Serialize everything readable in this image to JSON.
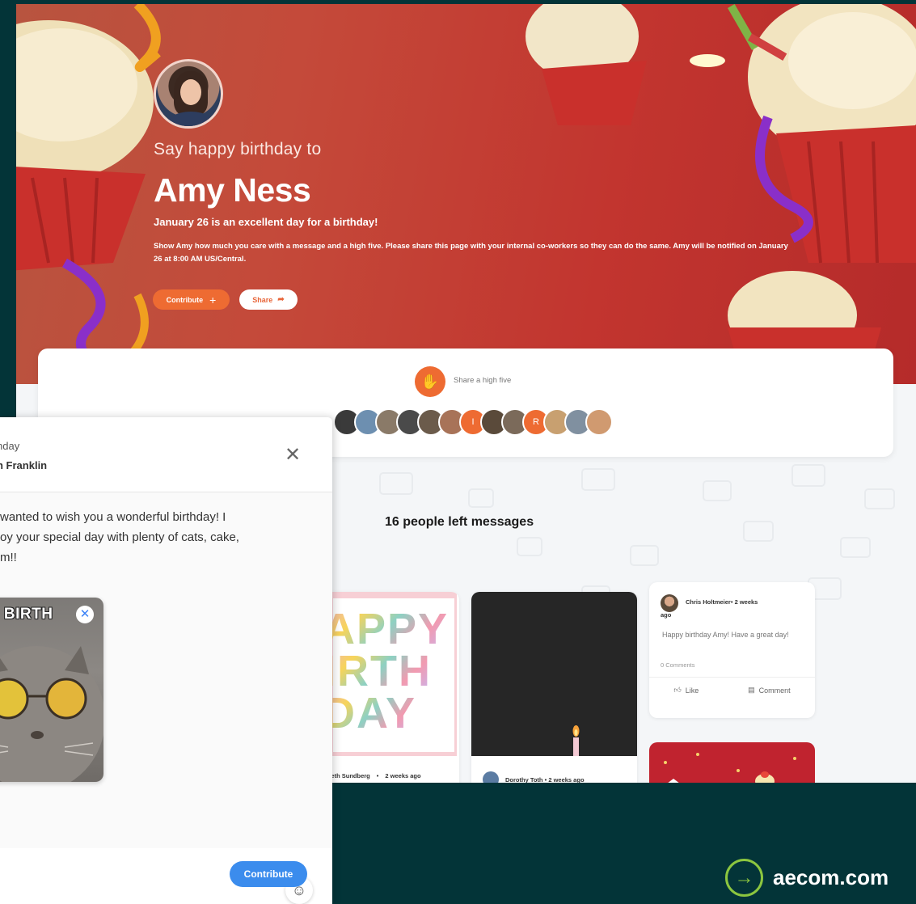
{
  "hero": {
    "say": "Say happy birthday to",
    "name": "Amy Ness",
    "subtitle": "January 26 is an excellent day for a birthday!",
    "description": "Show Amy how much you care with a message and a high five. Please share this page with your internal co-workers so they can do the same. Amy will be notified on January 26 at 8:00 AM US/Central.",
    "contribute_label": "Contribute",
    "share_label": "Share"
  },
  "highfive": {
    "label": "Share a high five",
    "avatars": [
      {
        "initial": "",
        "color": "#3a3a3a"
      },
      {
        "initial": "",
        "color": "#6d8fb0"
      },
      {
        "initial": "",
        "color": "#8a7a68"
      },
      {
        "initial": "",
        "color": "#4a4a4a"
      },
      {
        "initial": "",
        "color": "#6b5b4b"
      },
      {
        "initial": "",
        "color": "#a87358"
      },
      {
        "initial": "I",
        "color": "#ee6b32"
      },
      {
        "initial": "",
        "color": "#5a4a3a"
      },
      {
        "initial": "",
        "color": "#7b6a5a"
      },
      {
        "initial": "R",
        "color": "#ee6b32"
      },
      {
        "initial": "",
        "color": "#c8a070"
      },
      {
        "initial": "",
        "color": "#8090a0"
      },
      {
        "initial": "",
        "color": "#d09a70"
      }
    ]
  },
  "messages": {
    "count_label": "16 people left messages",
    "card1": {
      "art_lines": [
        "APPY",
        "IRTH",
        "DAY"
      ],
      "author": "Beth Sundberg",
      "time": "2 weeks ago"
    },
    "card2": {
      "author": "Dorothy Toth",
      "time": "2 weeks ago"
    },
    "card3": {
      "author": "Chris Holtmeier",
      "time_part1": "2 weeks",
      "time_part2": "ago",
      "message": "Happy birthday Amy! Have a great day!",
      "comments": "0 Comments",
      "like_label": "Like",
      "comment_label": "Comment"
    }
  },
  "modal": {
    "title": "nday",
    "subtitle": "n Franklin",
    "message_lines": [
      " wanted to wish you a wonderful birthday! I",
      "oy your special day with plenty of cats, cake,",
      "m!!"
    ],
    "gif_text": "MY BIRTH",
    "contribute_label": "Contribute"
  },
  "footer": {
    "brand": "aecom.com"
  },
  "colors": {
    "accent_orange": "#ee6b32",
    "accent_blue": "#3b8ced",
    "brand_green": "#8cc63f",
    "background": "#033438"
  }
}
